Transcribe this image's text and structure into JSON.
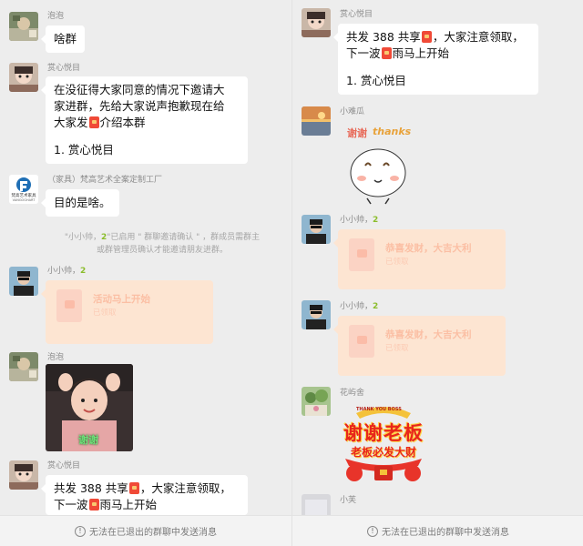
{
  "left": {
    "messages": [
      {
        "sender": "泡泡",
        "text": "啥群"
      },
      {
        "sender": "赏心悦目",
        "lines": [
          "在没征得大家同意的情况下邀请大",
          "家进群，先给大家说声抱歉现在给",
          "大家发",
          "介绍本群"
        ],
        "list_item": "1. 赏心悦目"
      },
      {
        "sender": "（家具）梵高艺术全案定制工厂",
        "text": "目的是啥。"
      },
      {
        "sender": "小小帅，",
        "packet_title": "活动马上开始",
        "packet_sub": "已领取"
      },
      {
        "sender": "泡泡",
        "photo_caption": "谢谢"
      },
      {
        "sender": "赏心悦目",
        "line1_a": "共发 388 共享",
        "line1_b": "，大家注意领取，",
        "line2_a": "下一波",
        "line2_b": "雨马上开始"
      }
    ],
    "system": {
      "prefix": "\"小小帅，",
      "middle": "\"已启用 \" 群聊邀请确认 \" ，群成员需群主",
      "line2": "或群管理员确认才能邀请朋友进群。"
    },
    "logo_text": "梵高艺术家具",
    "logo_sub": "VANGOGHART"
  },
  "right": {
    "messages": [
      {
        "sender": "赏心悦目",
        "line1_a": "共发 388 共享",
        "line1_b": "，大家注意领取，",
        "line2_a": "下一波",
        "line2_b": "雨马上开始",
        "list_item": "1. 赏心悦目"
      },
      {
        "sender": "小难瓜",
        "sticker_text_cn": "谢谢",
        "sticker_text_en": "thanks"
      },
      {
        "sender": "小小帅，",
        "packet_title": "恭喜发财，大吉大利",
        "packet_sub": "已领取"
      },
      {
        "sender": "小小帅，",
        "packet_title": "恭喜发财，大吉大利",
        "packet_sub": "已领取"
      },
      {
        "sender": "花屿舍",
        "sticker_line1": "谢谢老板",
        "sticker_line2": "老板必发大财",
        "sticker_top": "THANK YOU BOSS"
      },
      {
        "sender": "小芙"
      }
    ]
  },
  "bottom_bar": {
    "text": "无法在已退出的群聊中发送消息"
  },
  "badge": "2",
  "colors": {
    "background": "#ededed",
    "bubble": "#ffffff",
    "packet": "#fde5d2",
    "accent_green": "#8bbd2c"
  }
}
